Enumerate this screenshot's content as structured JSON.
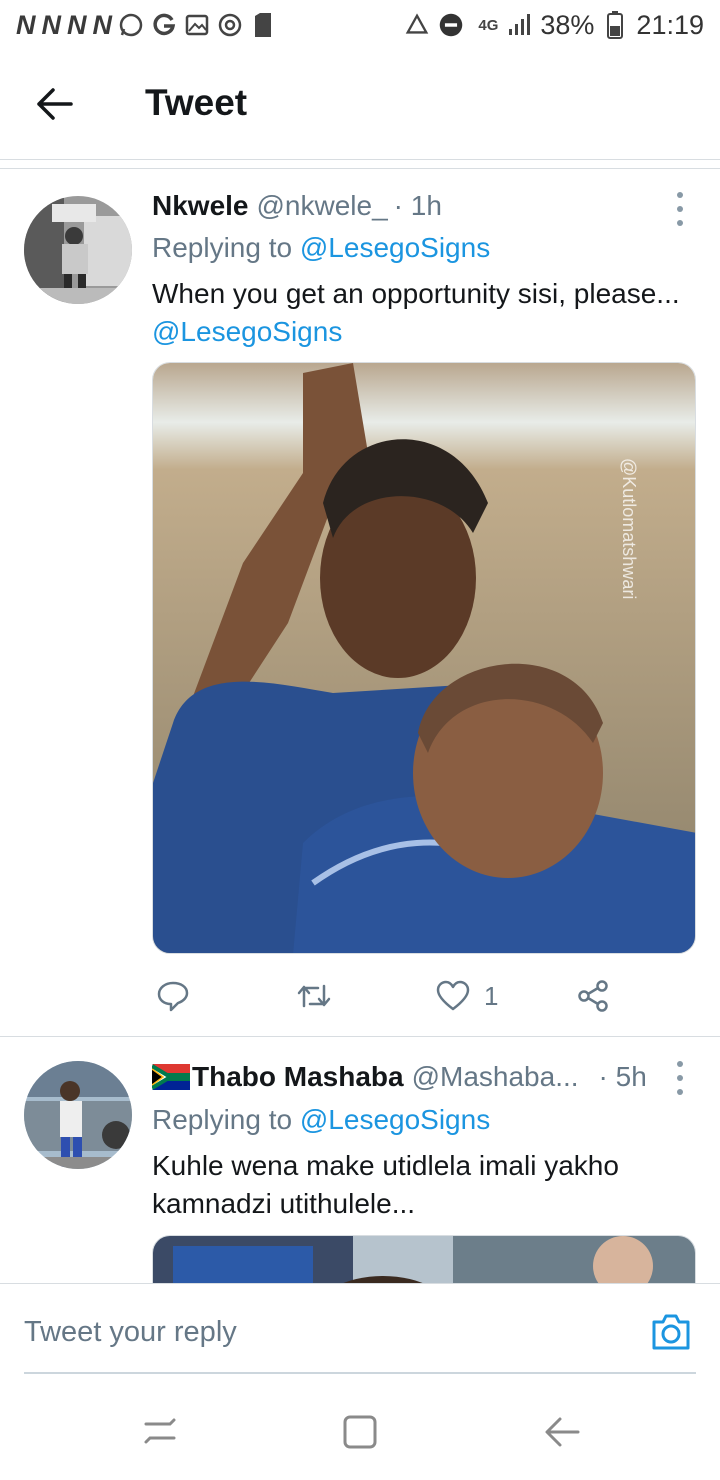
{
  "status_bar": {
    "notif_icons": [
      "N",
      "N",
      "N",
      "N"
    ],
    "network": "4G",
    "battery": "38%",
    "time": "21:19"
  },
  "header": {
    "title": "Tweet"
  },
  "tweets": [
    {
      "name": "Nkwele",
      "handle": "@nkwele_",
      "time": "· 1h",
      "replying_prefix": "Replying to ",
      "replying_to": "@LesegoSigns",
      "text": "When you get an opportunity sisi, please... ",
      "text_mention": "@LesegoSigns",
      "image_watermark": "@Kutlomatshwari",
      "like_count": "1"
    },
    {
      "flag": "south-africa-flag",
      "name": "Thabo Mashaba",
      "handle": "@Mashaba...",
      "time": "· 5h",
      "replying_prefix": "Replying to ",
      "replying_to": "@LesegoSigns",
      "text": "Kuhle wena make utidlela imali yakho kamnadzi utithulele..."
    }
  ],
  "reply_bar": {
    "placeholder": "Tweet your reply"
  },
  "colors": {
    "accent": "#1b95e0",
    "secondary_text": "#657786",
    "primary_text": "#14171a",
    "divider": "#d8dde1"
  }
}
